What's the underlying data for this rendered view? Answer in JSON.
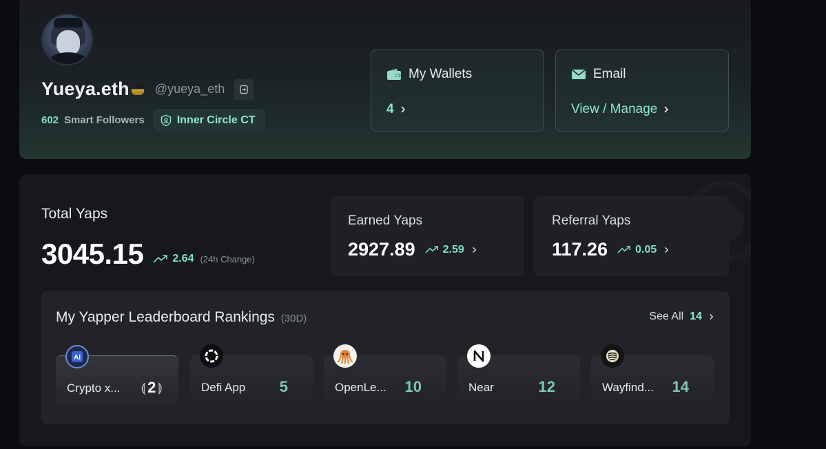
{
  "profile": {
    "username": "Yueya.eth",
    "handle": "@yueya_eth",
    "smart_followers_count": "602",
    "smart_followers_label": "Smart Followers",
    "badge_label": "Inner Circle CT"
  },
  "wallets": {
    "title": "My Wallets",
    "value": "4"
  },
  "email": {
    "title": "Email",
    "action": "View / Manage"
  },
  "stats": {
    "total_label": "Total Yaps",
    "total_value": "3045.15",
    "total_change": "2.64",
    "change_note": "(24h Change)",
    "earned_label": "Earned Yaps",
    "earned_value": "2927.89",
    "earned_change": "2.59",
    "referral_label": "Referral Yaps",
    "referral_value": "117.26",
    "referral_change": "0.05"
  },
  "rankings": {
    "title": "My Yapper Leaderboard Rankings",
    "period": "(30D)",
    "see_all_label": "See All",
    "see_all_count": "14",
    "items": [
      {
        "name": "Crypto x...",
        "rank": "2",
        "logo": "ai-icon"
      },
      {
        "name": "Defi App",
        "rank": "5",
        "logo": "defi-app-icon"
      },
      {
        "name": "OpenLe...",
        "rank": "10",
        "logo": "octopus-icon"
      },
      {
        "name": "Near",
        "rank": "12",
        "logo": "near-icon"
      },
      {
        "name": "Wayfind...",
        "rank": "14",
        "logo": "wayfinder-icon"
      }
    ]
  },
  "colors": {
    "accent": "#7ee0c4",
    "rank_number": "#7fc7b4",
    "card_bg": "#16181d",
    "panel_bg": "#212329"
  }
}
